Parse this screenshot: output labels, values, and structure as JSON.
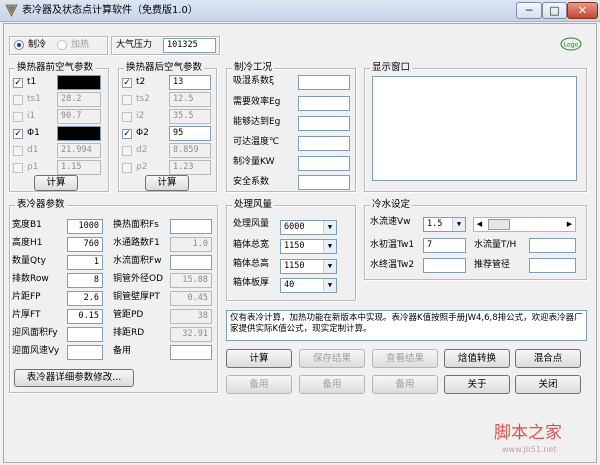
{
  "window": {
    "title": "表冷器及状态点计算软件（免费版1.0）",
    "min": "─",
    "max": "□",
    "close": "✕"
  },
  "mode": {
    "cooling": "制冷",
    "heating": "加热"
  },
  "pressure": {
    "label": "大气压力",
    "value": "101325"
  },
  "logo": "Logo",
  "before": {
    "title": "换热器前空气参数",
    "rows": [
      {
        "label": "t1",
        "value": ""
      },
      {
        "label": "ts1",
        "value": "28.2"
      },
      {
        "label": "i1",
        "value": "90.7"
      },
      {
        "label": "Φ1",
        "value": ""
      },
      {
        "label": "d1",
        "value": "21.994"
      },
      {
        "label": "ρ1",
        "value": "1.15"
      }
    ],
    "calc": "计算"
  },
  "after": {
    "title": "换热器后空气参数",
    "rows": [
      {
        "label": "t2",
        "value": "13"
      },
      {
        "label": "ts2",
        "value": "12.5"
      },
      {
        "label": "i2",
        "value": "35.5"
      },
      {
        "label": "Φ2",
        "value": "95"
      },
      {
        "label": "d2",
        "value": "8.859"
      },
      {
        "label": "ρ2",
        "value": "1.23"
      }
    ],
    "calc": "计算"
  },
  "cond": {
    "title": "制冷工况",
    "rows": [
      "吸湿系数ξ",
      "需要效率Eg",
      "能够达到Eg",
      "可达温度℃",
      "制冷量KW",
      "安全系数"
    ]
  },
  "display": {
    "title": "显示窗口"
  },
  "coil": {
    "title": "表冷器参数",
    "left": [
      {
        "label": "宽度B1",
        "value": "1000"
      },
      {
        "label": "高度H1",
        "value": "760"
      },
      {
        "label": "数量Qty",
        "value": "1"
      },
      {
        "label": "排数Row",
        "value": "8"
      },
      {
        "label": "片距FP",
        "value": "2.6"
      },
      {
        "label": "片厚FT",
        "value": "0.15"
      },
      {
        "label": "迎风面积Fy",
        "value": ""
      },
      {
        "label": "迎面风速Vy",
        "value": ""
      }
    ],
    "right": [
      {
        "label": "换热面积Fs",
        "value": ""
      },
      {
        "label": "水通路数F1",
        "value": "1.0"
      },
      {
        "label": "水流面积Fw",
        "value": ""
      },
      {
        "label": "铜管外径OD",
        "value": "15.88"
      },
      {
        "label": "铜管壁厚PT",
        "value": "0.45"
      },
      {
        "label": "管距PD",
        "value": "38"
      },
      {
        "label": "排距RD",
        "value": "32.91"
      },
      {
        "label": "备用",
        "value": ""
      }
    ],
    "detail_btn": "表冷器详细参数修改..."
  },
  "airflow": {
    "title": "处理风量",
    "rows": [
      {
        "label": "处理风量",
        "value": "6000"
      },
      {
        "label": "箱体总宽",
        "value": "1150"
      },
      {
        "label": "箱体总高",
        "value": "1150"
      },
      {
        "label": "箱体板厚",
        "value": "40"
      }
    ]
  },
  "water": {
    "title": "冷水设定",
    "speed_label": "水流速Vw",
    "speed_value": "1.5",
    "inlet_label": "水初温Tw1",
    "inlet_value": "7",
    "outlet_label": "水终温Tw2",
    "outlet_value": "",
    "flow_label": "水流量T/H",
    "flow_value": "",
    "pipe_label": "推荐管径",
    "pipe_value": ""
  },
  "info": "仅有表冷计算，加热功能在新版本中实现。表冷器K值按照手册JW4,6,8排公式，欢迎表冷器厂家提供实际K值公式，现实定制计算。",
  "buttons": {
    "row1": [
      "计算",
      "保存结果",
      "查看结果",
      "焓值转换",
      "混合点"
    ],
    "row2": [
      "备用",
      "备用",
      "备用",
      "关于",
      "关闭"
    ]
  },
  "watermark": {
    "main": "脚本之家",
    "sub": "www.jb51.net"
  }
}
